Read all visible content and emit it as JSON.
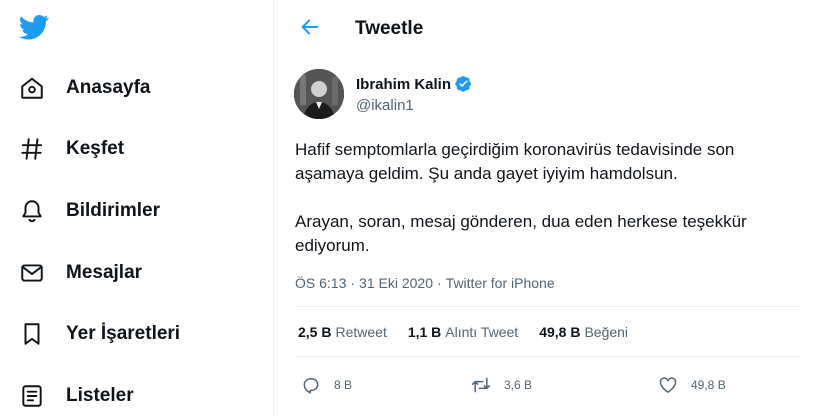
{
  "colors": {
    "brand": "#1d9bf0",
    "text": "#0f1419",
    "muted": "#536471",
    "divider": "#ebeef0"
  },
  "logo": {
    "icon": "twitter-bird-icon"
  },
  "nav": {
    "items": [
      {
        "label": "Anasayfa",
        "icon": "home-icon"
      },
      {
        "label": "Keşfet",
        "icon": "hashtag-icon"
      },
      {
        "label": "Bildirimler",
        "icon": "bell-icon"
      },
      {
        "label": "Mesajlar",
        "icon": "envelope-icon"
      },
      {
        "label": "Yer İşaretleri",
        "icon": "bookmark-icon"
      },
      {
        "label": "Listeler",
        "icon": "list-icon"
      }
    ]
  },
  "header": {
    "title": "Tweetle",
    "back_icon": "back-arrow-icon"
  },
  "tweet": {
    "author_name": "Ibrahim Kalin",
    "author_handle": "@ikalin1",
    "verified": true,
    "paragraphs": [
      "Hafif semptomlarla geçirdiğim koronavirüs tedavisinde son aşamaya geldim. Şu anda gayet iyiyim hamdolsun.",
      "Arayan, soran, mesaj gönderen, dua eden herkese teşekkür ediyorum."
    ],
    "time": "ÖS 6:13",
    "date": "31 Eki 2020",
    "separator": "·",
    "source": "Twitter for iPhone"
  },
  "stats": {
    "retweets": {
      "value": "2,5 B",
      "label": "Retweet"
    },
    "quotes": {
      "value": "1,1 B",
      "label": "Alıntı Tweet"
    },
    "likes": {
      "value": "49,8 B",
      "label": "Beğeni"
    }
  },
  "actions": {
    "reply": {
      "count": "8 B",
      "icon": "reply-icon"
    },
    "retweet": {
      "count": "3,6 B",
      "icon": "retweet-icon"
    },
    "like": {
      "count": "49,8 B",
      "icon": "heart-icon"
    }
  }
}
